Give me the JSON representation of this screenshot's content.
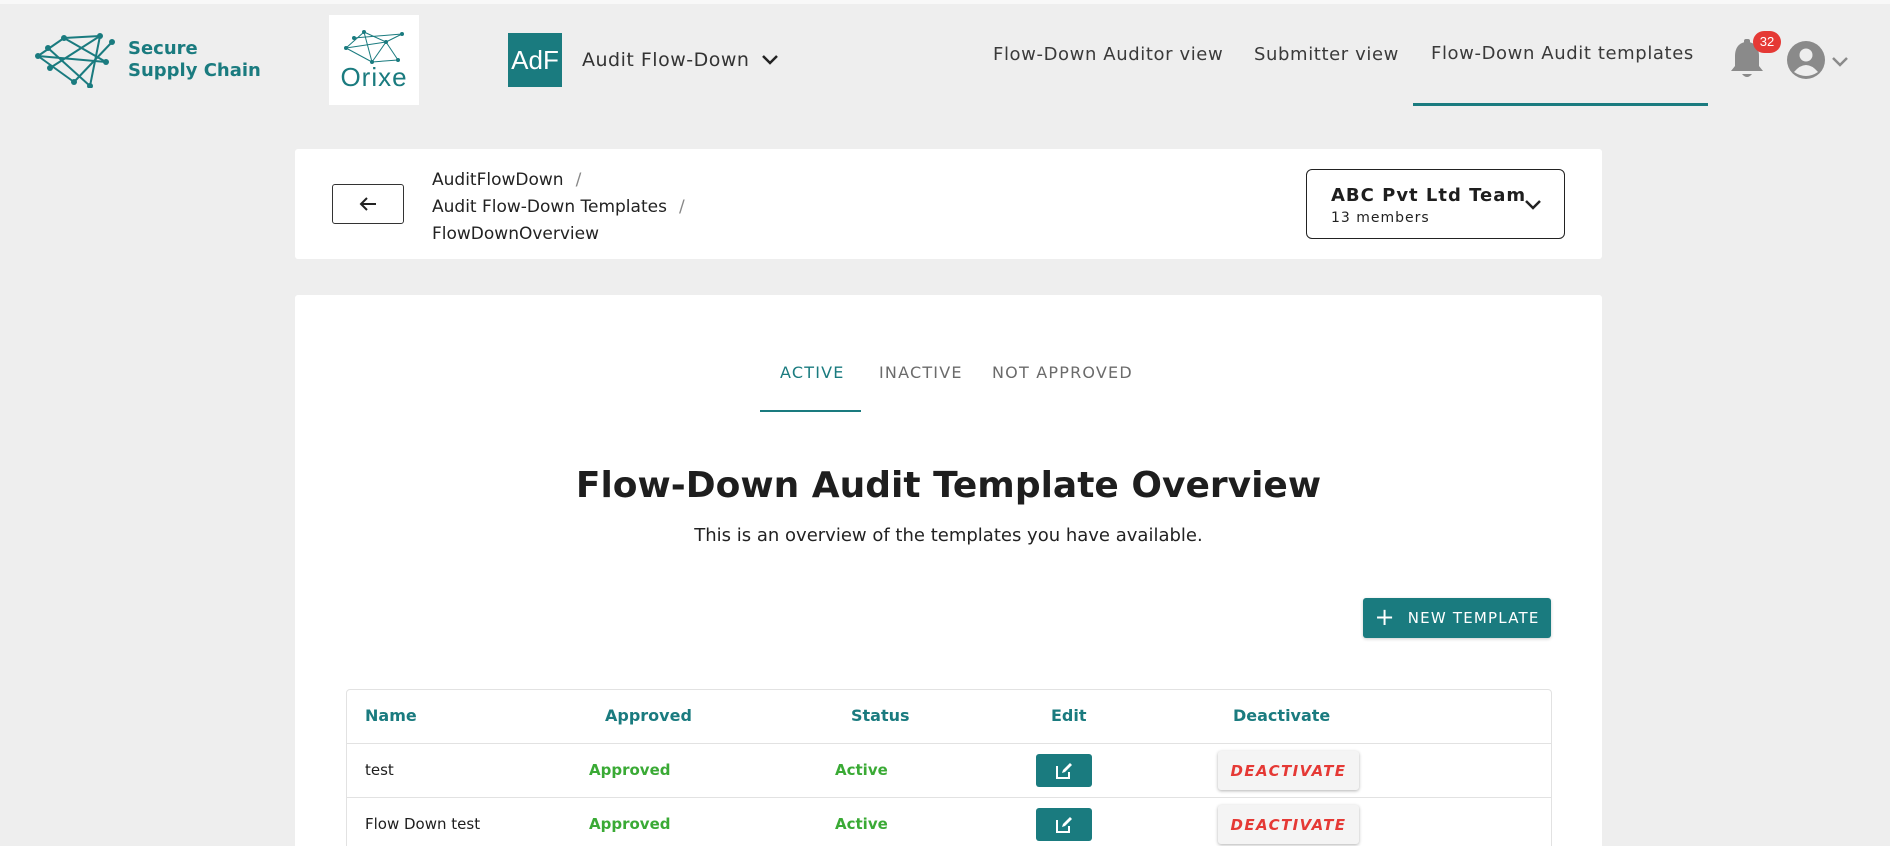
{
  "brand": {
    "line1": "Secure",
    "line2": "Supply Chain"
  },
  "org_logo": {
    "text": "Orixe"
  },
  "app": {
    "badge": "AdF",
    "name": "Audit Flow-Down"
  },
  "nav": {
    "items": [
      {
        "label": "Flow-Down Auditor view"
      },
      {
        "label": "Submitter view"
      },
      {
        "label": "Flow-Down Audit templates",
        "active": true
      }
    ],
    "notification_count": "32"
  },
  "breadcrumb": {
    "items": [
      "AuditFlowDown",
      "Audit Flow-Down Templates",
      "FlowDownOverview"
    ],
    "separator": "/"
  },
  "team": {
    "name": "ABC Pvt Ltd Team",
    "members": "13 members"
  },
  "tabs": [
    {
      "label": "ACTIVE",
      "active": true
    },
    {
      "label": "INACTIVE"
    },
    {
      "label": "NOT APPROVED"
    }
  ],
  "page": {
    "title": "Flow-Down Audit Template Overview",
    "subtitle": "This is an overview of the templates you have available.",
    "new_button": "NEW TEMPLATE"
  },
  "table": {
    "columns": [
      "Name",
      "Approved",
      "Status",
      "Edit",
      "Deactivate"
    ],
    "rows": [
      {
        "name": "test",
        "approved": "Approved",
        "status": "Active",
        "action": "DEACTIVATE"
      },
      {
        "name": "Flow Down test",
        "approved": "Approved",
        "status": "Active",
        "action": "DEACTIVATE"
      }
    ]
  },
  "colors": {
    "primary": "#1a7b7f",
    "approved_green": "#3aaa35",
    "danger": "#e53935",
    "background": "#eeeeee"
  }
}
